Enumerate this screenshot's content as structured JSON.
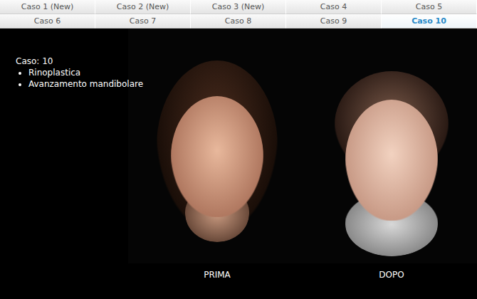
{
  "tabs": [
    {
      "label": "Caso 1 (New)",
      "selected": false
    },
    {
      "label": "Caso 2 (New)",
      "selected": false
    },
    {
      "label": "Caso 3 (New)",
      "selected": false
    },
    {
      "label": "Caso 4",
      "selected": false
    },
    {
      "label": "Caso 5",
      "selected": false
    },
    {
      "label": "Caso 6",
      "selected": false
    },
    {
      "label": "Caso 7",
      "selected": false
    },
    {
      "label": "Caso 8",
      "selected": false
    },
    {
      "label": "Caso 9",
      "selected": false
    },
    {
      "label": "Caso 10",
      "selected": true
    }
  ],
  "case": {
    "title": "Caso: 10",
    "procedures": [
      "Rinoplastica",
      "Avanzamento mandibolare"
    ]
  },
  "photos": [
    {
      "label": "PRIMA"
    },
    {
      "label": "DOPO"
    }
  ]
}
